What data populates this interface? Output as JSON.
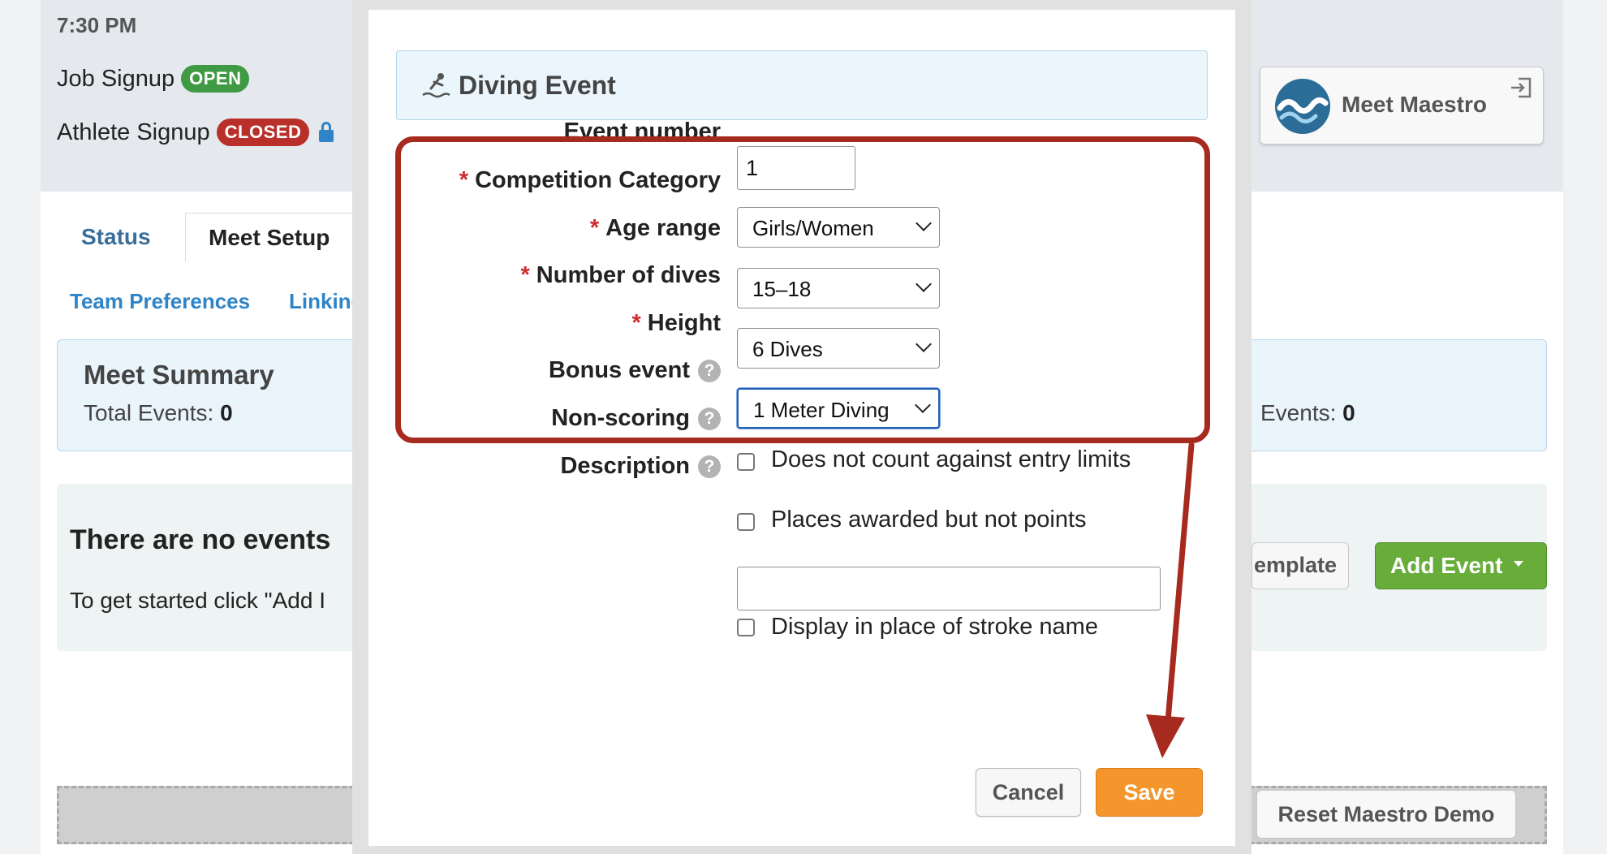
{
  "background": {
    "date_line": "7:30 PM",
    "job_signup": {
      "label": "Job Signup",
      "badge": "OPEN"
    },
    "athlete_signup": {
      "label": "Athlete Signup",
      "badge": "CLOSED"
    },
    "tabs": [
      {
        "label": "Status"
      },
      {
        "label": "Meet Setup"
      }
    ],
    "subnav": [
      {
        "label": "Team Preferences"
      },
      {
        "label": "Linking"
      }
    ],
    "summary": {
      "title": "Meet Summary",
      "total_events_label": "Total Events:",
      "total_events_value": "0",
      "right_events_label": "Events:",
      "right_events_value": "0"
    },
    "events_panel": {
      "title": "There are no events",
      "text": "To get started click \"Add I",
      "template_button": "emplate",
      "add_event_button": "Add Event"
    },
    "meet_maestro_button": "Meet Maestro",
    "reset_button": "Reset Maestro Demo"
  },
  "modal": {
    "title": "Diving Event",
    "title_icon": "diver-icon",
    "fields": {
      "event_number": {
        "label": "Event number",
        "value": "1"
      },
      "competition_category": {
        "label": "Competition Category",
        "value": "Girls/Women"
      },
      "age_range": {
        "label": "Age range",
        "value": "15–18"
      },
      "number_of_dives": {
        "label": "Number of dives",
        "value": "6 Dives"
      },
      "height": {
        "label": "Height",
        "value": "1 Meter Diving"
      },
      "bonus_event": {
        "label": "Bonus event",
        "checkbox_text": "Does not count against entry limits",
        "checked": false
      },
      "non_scoring": {
        "label": "Non-scoring",
        "checkbox_text": "Places awarded but not points",
        "checked": false
      },
      "description": {
        "label": "Description",
        "value": "",
        "checkbox_text": "Display in place of stroke name",
        "checked": false
      }
    },
    "required_marker": "*",
    "help_glyph": "?",
    "cancel_label": "Cancel",
    "save_label": "Save"
  },
  "annotation_color": "#a72a1f"
}
